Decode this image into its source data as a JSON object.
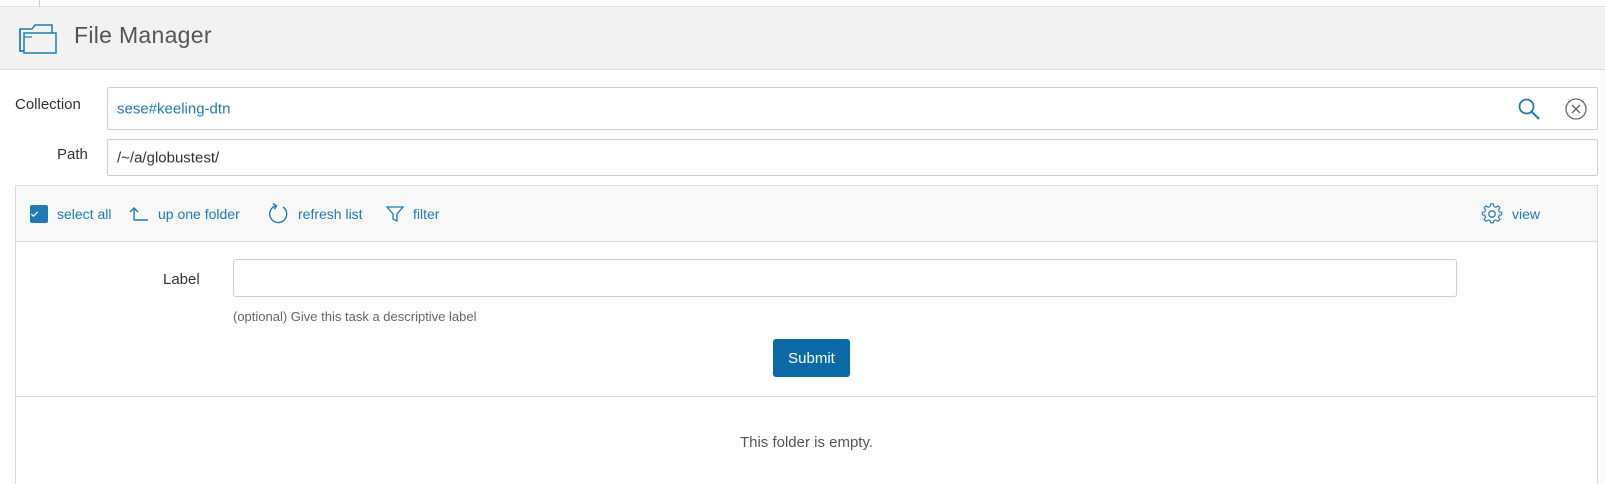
{
  "header": {
    "title": "File Manager",
    "icon": "folder-icon"
  },
  "collection": {
    "label": "Collection",
    "value": "sese#keeling-dtn",
    "search_icon": "search-icon",
    "clear_icon": "clear-circle-icon"
  },
  "path": {
    "label": "Path",
    "value": "/~/a/globustest/"
  },
  "toolbar": {
    "select_all": "select all",
    "select_all_checked": true,
    "up_one_folder": "up one folder",
    "refresh_list": "refresh list",
    "filter": "filter",
    "view": "view"
  },
  "task_form": {
    "label": "Label",
    "value": "",
    "helper": "(optional) Give this task a descriptive label",
    "submit": "Submit"
  },
  "listing": {
    "empty_message": "This folder is empty."
  },
  "colors": {
    "accent": "#1f7bb6",
    "submit_bg": "#0a6aa8",
    "header_bg": "#f2f2f2"
  }
}
